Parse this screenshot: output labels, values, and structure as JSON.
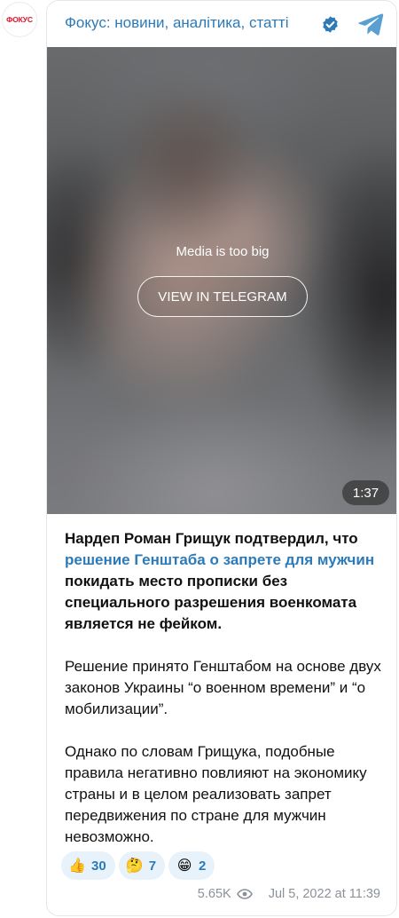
{
  "channel": {
    "avatar_text": "ФОКУС",
    "name": "Фокус: новини, аналітика, статті"
  },
  "media": {
    "notice": "Media is too big",
    "button_label": "VIEW IN TELEGRAM",
    "duration": "1:37"
  },
  "post": {
    "p1_bold_a": "Нардеп Роман Грищук подтвердил, что ",
    "p1_link": "решение Генштаба о запрете для мужчин",
    "p1_bold_b": " покидать место прописки без специального разрешения военкомата является не фейком.",
    "p2": "Решение принято Генштабом на основе двух законов Украины “о военном времени” и “о мобилизации”.",
    "p3": "Однако по словам Грищука, подобные правила негативно повлияют на экономику страны и в целом реализовать запрет передвижения по стране для мужчин невозможно."
  },
  "reactions": [
    {
      "emoji": "👍",
      "count": "30"
    },
    {
      "emoji": "🤔",
      "count": "7"
    },
    {
      "emoji": "😁",
      "count": "2"
    }
  ],
  "footer": {
    "views": "5.65K",
    "datetime": "Jul 5, 2022 at 11:39"
  },
  "colors": {
    "accent": "#2c7ab8",
    "brand_red": "#e1122a",
    "reaction_bg": "#e8f2fa",
    "meta_gray": "#8a9199"
  },
  "icons": {
    "verified": "verified-badge-icon",
    "telegram": "telegram-plane-icon",
    "views": "eye-icon"
  }
}
